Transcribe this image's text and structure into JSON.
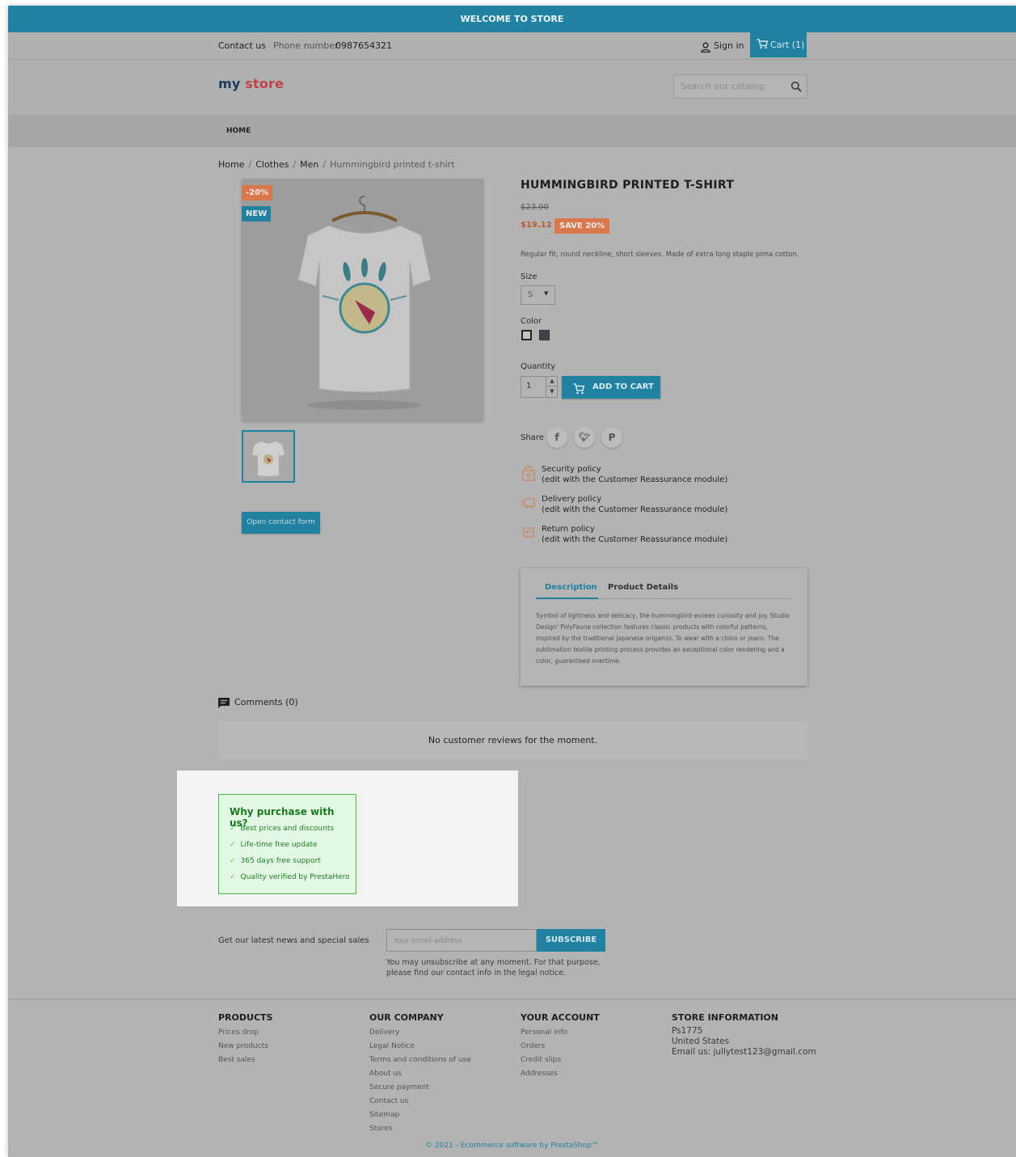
{
  "banner": {
    "text": "WELCOME TO STORE"
  },
  "topbar": {
    "contact_label": "Contact us",
    "phone_label": "Phone number",
    "phone_value": "0987654321",
    "signin_label": "Sign in",
    "cart_label": "Cart (1)"
  },
  "header": {
    "logo_my": "my",
    "logo_store": "store",
    "search_placeholder": "Search our catalog"
  },
  "nav": {
    "home": "HOME"
  },
  "breadcrumb": [
    "Home",
    "Clothes",
    "Men",
    "Hummingbird printed t-shirt"
  ],
  "product": {
    "flag_discount": "-20%",
    "flag_new": "NEW",
    "title": "HUMMINGBIRD PRINTED T-SHIRT",
    "old_price": "$23.90",
    "new_price": "$19.12",
    "save_badge": "SAVE 20%",
    "short_desc": "Regular fit, round neckline, short sleeves. Made of extra long staple pima cotton.",
    "size_label": "Size",
    "size_value": "S",
    "color_label": "Color",
    "colors": [
      "#ffffff",
      "#434a54"
    ],
    "quantity_label": "Quantity",
    "quantity_value": "1",
    "add_to_cart": "ADD TO CART",
    "share_label": "Share",
    "contact_form_btn": "Open contact form"
  },
  "reassurance": [
    {
      "icon": "security-icon",
      "title": "Security policy",
      "sub": "(edit with the Customer Reassurance module)"
    },
    {
      "icon": "delivery-icon",
      "title": "Delivery policy",
      "sub": "(edit with the Customer Reassurance module)"
    },
    {
      "icon": "return-icon",
      "title": "Return policy",
      "sub": "(edit with the Customer Reassurance module)"
    }
  ],
  "tabs": {
    "description": "Description",
    "details": "Product Details",
    "body": "Symbol of lightness and delicacy, the hummingbird evokes curiosity and joy. Studio Design' PolyFaune collection features classic products with colorful patterns, inspired by the traditional japanese origamis. To wear with a chino or jeans. The sublimation textile printing process provides an exceptional color rendering and a color, guaranteed overtime."
  },
  "comments": {
    "label": "Comments (0)",
    "empty": "No customer reviews for the moment."
  },
  "why": {
    "title": "Why purchase with us?",
    "items": [
      "Best prices and discounts",
      "Life-time free update",
      "365 days free support",
      "Quality verified by PrestaHero"
    ]
  },
  "newsletter": {
    "label": "Get our latest news and special sales",
    "placeholder": "Your email address",
    "button": "SUBSCRIBE",
    "note_line1": "You may unsubscribe at any moment. For that purpose,",
    "note_line2": "please find our contact info in the legal notice."
  },
  "footer": {
    "products": {
      "title": "PRODUCTS",
      "links": [
        "Prices drop",
        "New products",
        "Best sales"
      ]
    },
    "company": {
      "title": "OUR COMPANY",
      "links": [
        "Delivery",
        "Legal Notice",
        "Terms and conditions of use",
        "About us",
        "Secure payment",
        "Contact us",
        "Sitemap",
        "Stores"
      ]
    },
    "account": {
      "title": "YOUR ACCOUNT",
      "links": [
        "Personal info",
        "Orders",
        "Credit slips",
        "Addresses"
      ]
    },
    "store": {
      "title": "STORE INFORMATION",
      "lines": [
        "Ps1775",
        "United States",
        "Email us: jullytest123@gmail.com"
      ]
    },
    "copyright": "© 2021 - Ecommerce software by PrestaShop™"
  },
  "colors": {
    "primary": "#2181a0",
    "discount": "#d9784d",
    "why_green": "#3fbd45"
  }
}
